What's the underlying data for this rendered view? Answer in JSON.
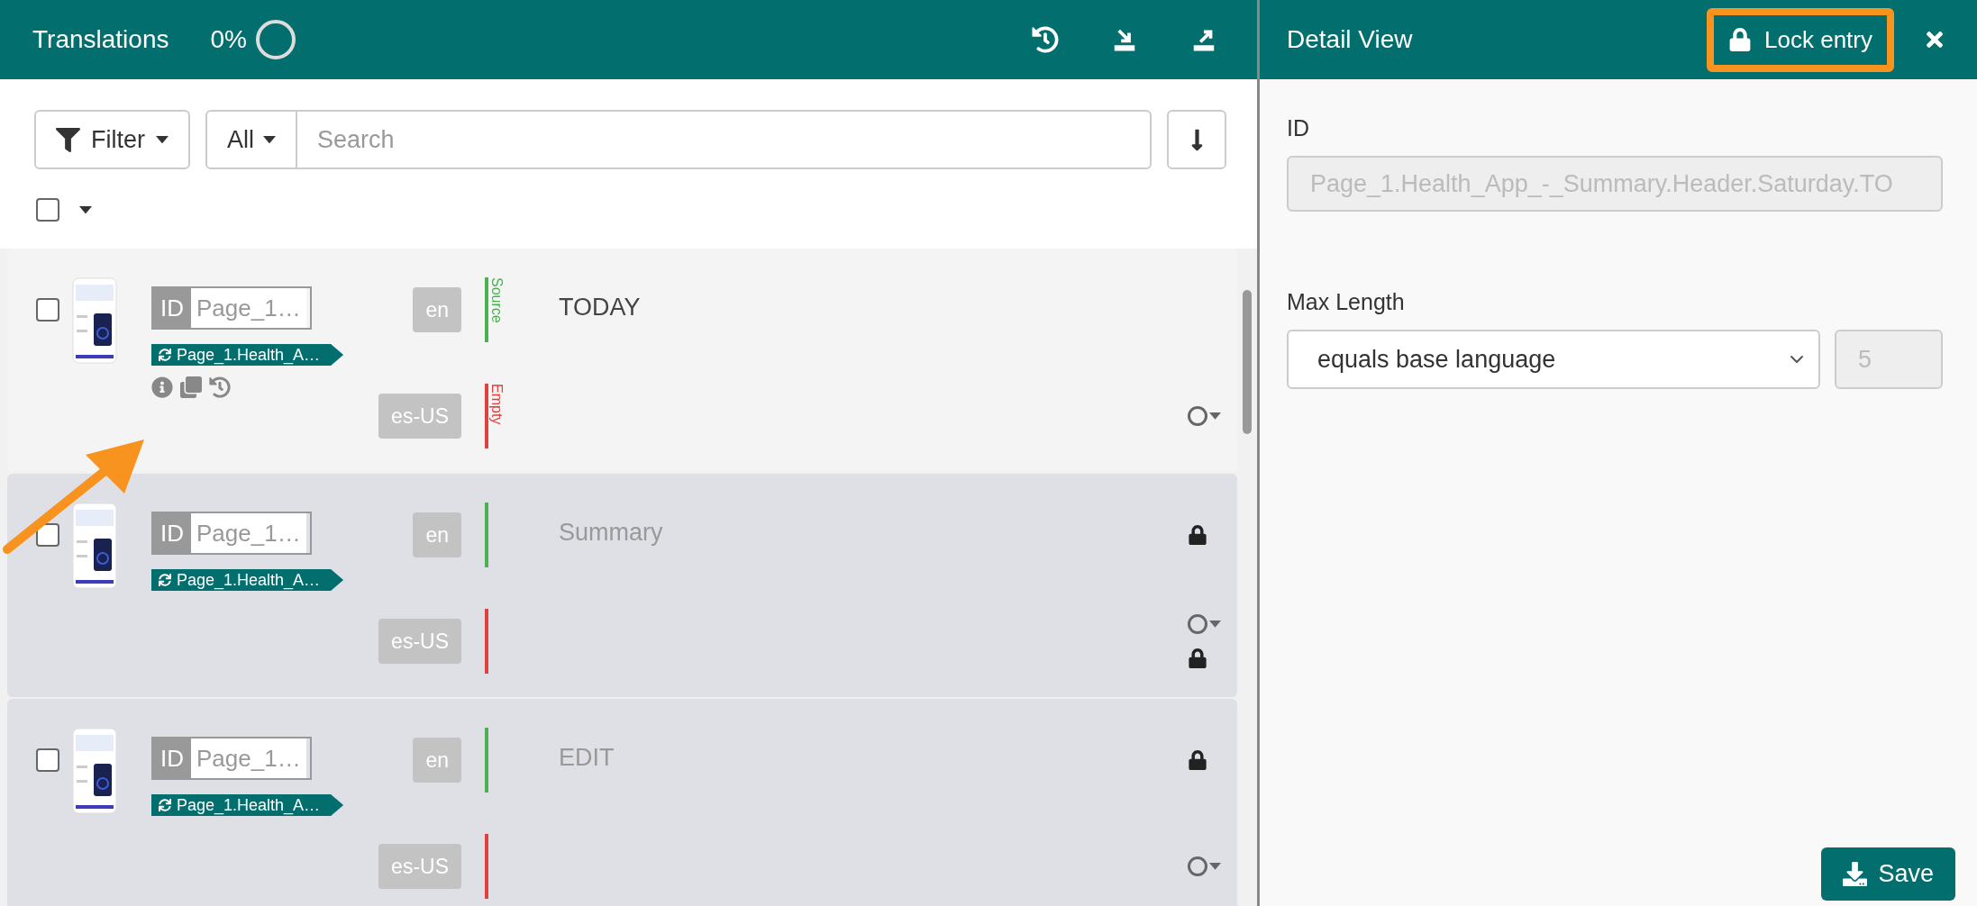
{
  "translations_panel": {
    "title": "Translations",
    "progress": "0%"
  },
  "toolbar": {
    "filter": "Filter",
    "scope": "All",
    "search": {
      "placeholder": "Search"
    }
  },
  "select_all": {
    "checked": false
  },
  "entries": [
    {
      "checked": false,
      "selected": true,
      "id_label": "ID",
      "id_value": "Page_1…",
      "key_tag": "Page_1.Health_A…",
      "show_tools": true,
      "translations": [
        {
          "language": "en",
          "status": "Source",
          "color": "#4caf50",
          "text": "TODAY",
          "locked": false,
          "status_menu": false
        },
        {
          "language": "es-US",
          "status": "Empty",
          "color": "#e0413e",
          "locked": false,
          "status_menu": true
        }
      ]
    },
    {
      "checked": false,
      "selected": false,
      "id_label": "ID",
      "id_value": "Page_1…",
      "key_tag": "Page_1.Health_A…",
      "show_tools": false,
      "translations": [
        {
          "language": "en",
          "color": "#4caf50",
          "text": "Summary",
          "locked": true,
          "status_menu": false
        },
        {
          "language": "es-US",
          "color": "#e0413e",
          "locked": true,
          "status_menu": true
        }
      ]
    },
    {
      "checked": false,
      "selected": false,
      "id_label": "ID",
      "id_value": "Page_1…",
      "key_tag": "Page_1.Health_A…",
      "show_tools": false,
      "translations": [
        {
          "language": "en",
          "color": "#4caf50",
          "text": "EDIT",
          "locked": true,
          "status_menu": false
        },
        {
          "language": "es-US",
          "color": "#e0413e",
          "locked": false,
          "status_menu": true
        }
      ]
    }
  ],
  "detail": {
    "title": "Detail View",
    "lock_button": "Lock entry",
    "lock_highlighted": true,
    "id_label": "ID",
    "id_value": "Page_1.Health_App_-_Summary.Header.Saturday.TO",
    "max_length_label": "Max Length",
    "max_length_mode": "equals base language",
    "max_length_value": "5",
    "save": "Save"
  }
}
